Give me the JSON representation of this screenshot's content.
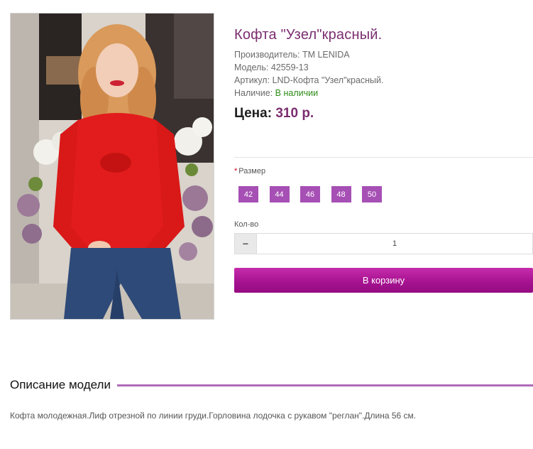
{
  "product": {
    "title": "Кофта \"Узел\"красный.",
    "manufacturer_label": "Производитель:",
    "manufacturer_value": "TM LENIDA",
    "model_label": "Модель:",
    "model_value": "42559-13",
    "article_label": "Артикул:",
    "article_value": "LND-Кофта \"Узел\"красный.",
    "availability_label": "Наличие:",
    "availability_value": "В наличии",
    "price_label": "Цена:",
    "price_value": "310 р."
  },
  "options": {
    "size_required_mark": "*",
    "size_label": "Размер",
    "sizes": [
      "42",
      "44",
      "46",
      "48",
      "50"
    ],
    "qty_label": "Кол-во",
    "qty_value": "1",
    "minus_symbol": "−"
  },
  "cart": {
    "button_label": "В корзину"
  },
  "description": {
    "heading": "Описание модели",
    "text": "Кофта молодежная.Лиф отрезной по линии груди.Горловина лодочка с рукавом \"реглан\".Длина 56 см."
  },
  "colors": {
    "accent_purple": "#a64fb4",
    "title_purple": "#7b2d6f",
    "button_magenta": "#a71391",
    "in_stock_green": "#2e8b17"
  }
}
